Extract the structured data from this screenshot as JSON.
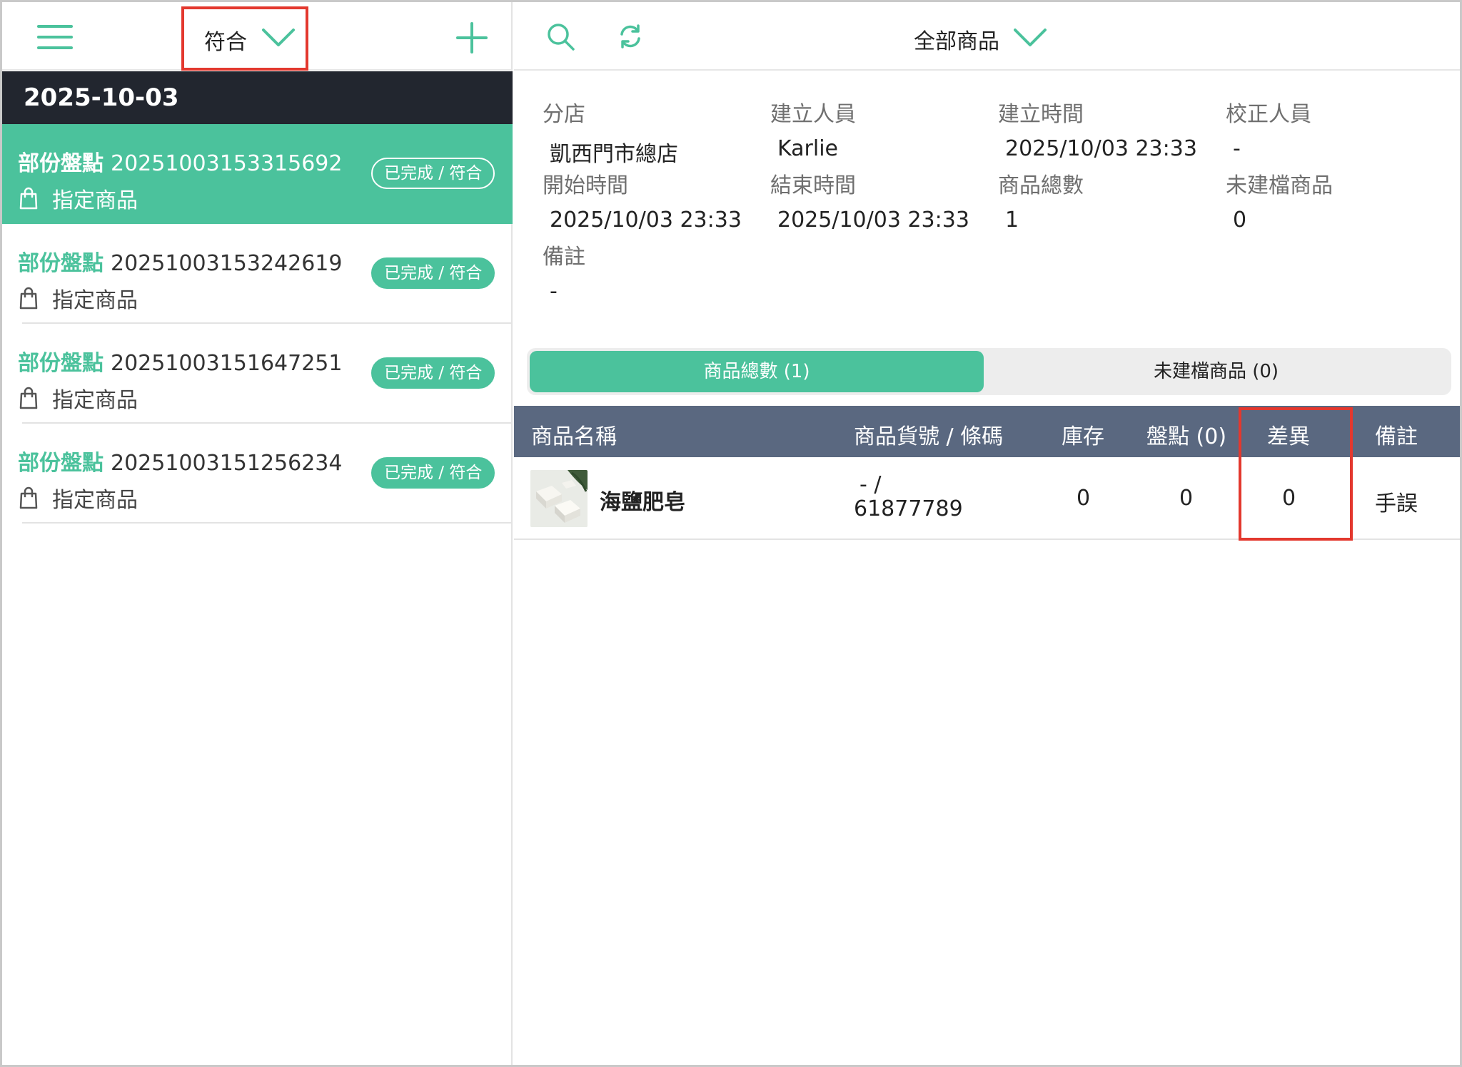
{
  "left_header": {
    "filter_label": "符合"
  },
  "date_header": "2025-10-03",
  "records": [
    {
      "type": "部份盤點",
      "number": "20251003153315692",
      "subtitle": "指定商品",
      "status": "已完成 / 符合"
    },
    {
      "type": "部份盤點",
      "number": "20251003153242619",
      "subtitle": "指定商品",
      "status": "已完成 / 符合"
    },
    {
      "type": "部份盤點",
      "number": "20251003151647251",
      "subtitle": "指定商品",
      "status": "已完成 / 符合"
    },
    {
      "type": "部份盤點",
      "number": "20251003151256234",
      "subtitle": "指定商品",
      "status": "已完成 / 符合"
    }
  ],
  "right_header": {
    "category_label": "全部商品"
  },
  "info": {
    "branch_label": "分店",
    "branch_value": "凱西門市總店",
    "creator_label": "建立人員",
    "creator_value": "Karlie",
    "created_time_label": "建立時間",
    "created_time_value": "2025/10/03 23:33",
    "corrector_label": "校正人員",
    "corrector_value": "-",
    "start_label": "開始時間",
    "start_value": "2025/10/03 23:33",
    "end_label": "結束時間",
    "end_value": "2025/10/03 23:33",
    "total_label": "商品總數",
    "total_value": "1",
    "unregistered_label": "未建檔商品",
    "unregistered_value": "0",
    "note_label": "備註",
    "note_value": "-"
  },
  "tabs": {
    "total": "商品總數 (1)",
    "unregistered": "未建檔商品 (0)"
  },
  "table": {
    "headers": {
      "name": "商品名稱",
      "sku": "商品貨號 / 條碼",
      "stock": "庫存",
      "counted": "盤點 (0)",
      "diff": "差異",
      "note": "備註"
    },
    "rows": [
      {
        "name": "海鹽肥皂",
        "sku_line1": "- /",
        "sku_line2": "61877789",
        "stock": "0",
        "counted": "0",
        "diff": "0",
        "note": "手誤"
      }
    ]
  },
  "colors": {
    "accent": "#4bc29c",
    "dark_bar": "#22262f",
    "table_header": "#5a6880",
    "highlight": "#e3382e"
  }
}
